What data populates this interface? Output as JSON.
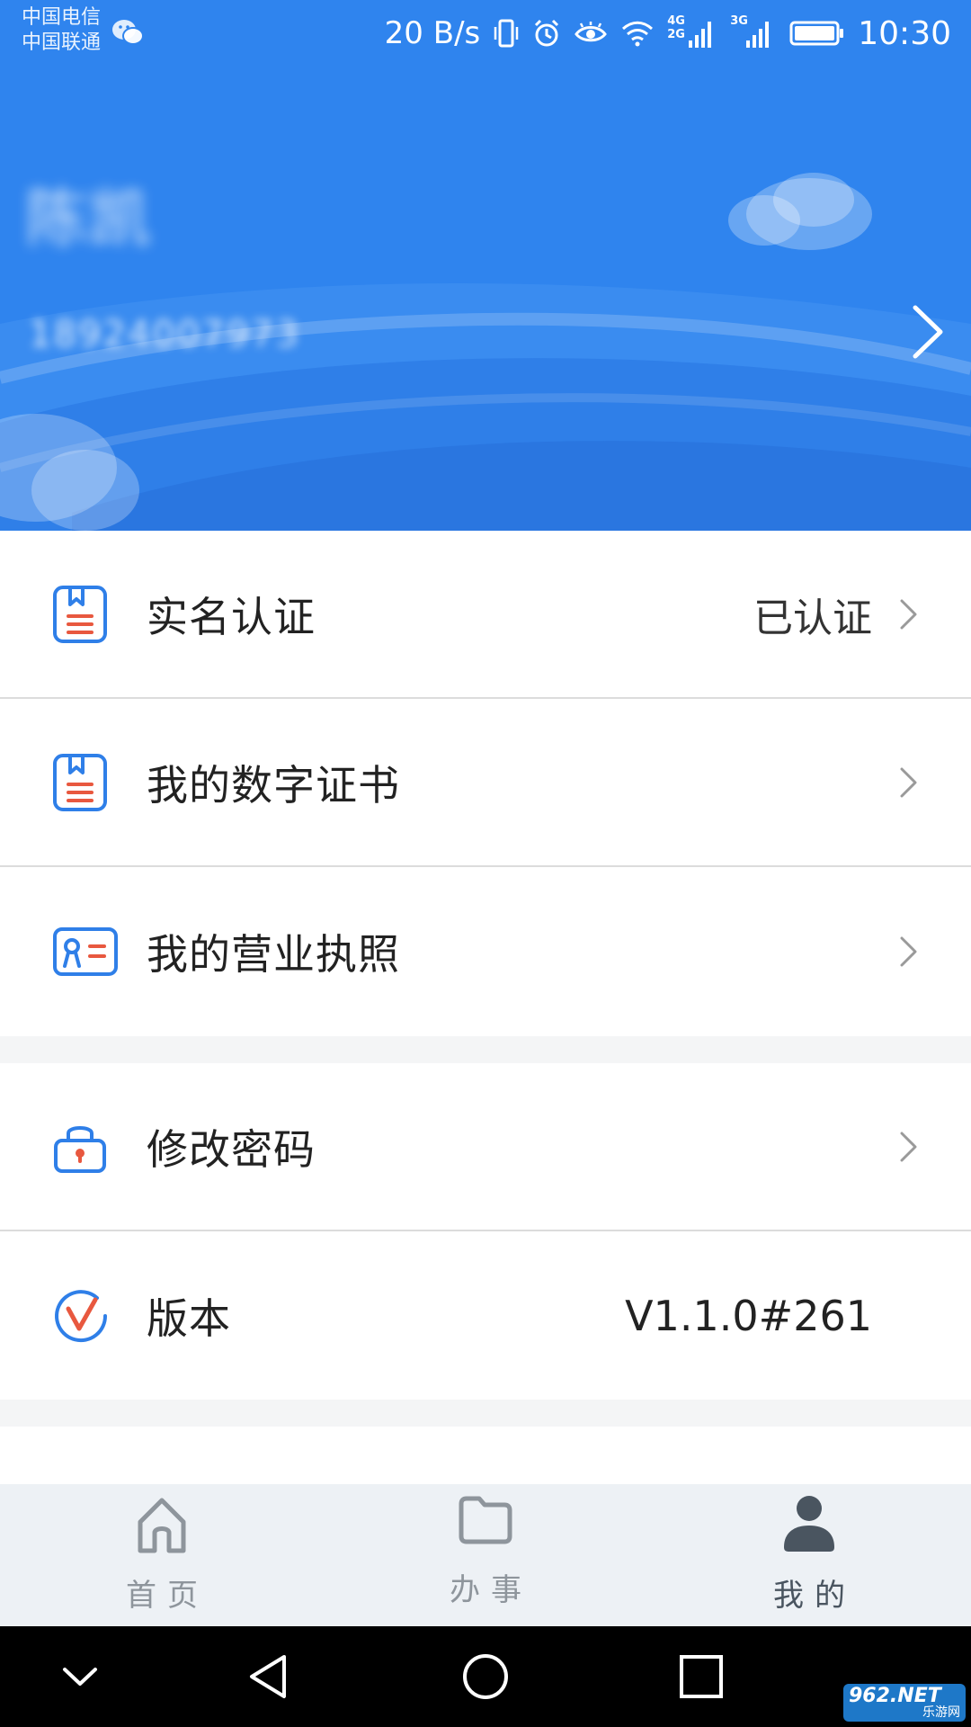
{
  "status_bar": {
    "carrier_1": "中国电信",
    "carrier_2": "中国联通",
    "net_speed": "20 B/s",
    "network_1": "4G",
    "network_2": "2G",
    "network_3": "3G",
    "time": "10:30"
  },
  "profile": {
    "name": "陈凯",
    "phone": "18924007973"
  },
  "menu": {
    "real_name": {
      "label": "实名认证",
      "value": "已认证"
    },
    "digital_cert": {
      "label": "我的数字证书"
    },
    "business_license": {
      "label": "我的营业执照"
    },
    "change_password": {
      "label": "修改密码"
    },
    "version": {
      "label": "版本",
      "value": "V1.1.0#261"
    }
  },
  "tabs": [
    {
      "label": "首页",
      "icon": "home-icon",
      "active": false
    },
    {
      "label": "办事",
      "icon": "folder-icon",
      "active": false
    },
    {
      "label": "我的",
      "icon": "person-icon",
      "active": true
    }
  ],
  "watermark": {
    "top": "962.NET",
    "bottom": "乐游网"
  },
  "colors": {
    "header_blue": "#2f84ee",
    "icon_blue": "#2f7fe8",
    "icon_red": "#e8583f",
    "tab_active": "#4a5560",
    "tab_inactive": "#8e959c"
  }
}
